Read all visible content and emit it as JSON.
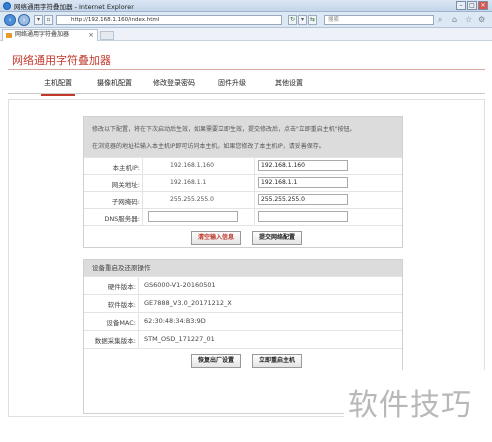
{
  "window": {
    "title": "网络通用字符叠加器 - Internet Explorer",
    "minimize": "–",
    "maximize": "□",
    "close": "✕"
  },
  "addressbar": {
    "url": "http://192.168.1.160/index.html",
    "search_placeholder": "搜索"
  },
  "tab": {
    "label": "网络通用字符叠加器"
  },
  "page": {
    "title": "网络通用字符叠加器",
    "menu": [
      "主机配置",
      "摄像机配置",
      "修改登录密码",
      "固件升级",
      "其他设置"
    ]
  },
  "network": {
    "notice": [
      "修改以下配置，将在下次启动后生效，如果需要立即生效，提交修改后，点击\"立即重启主机\"按钮。",
      "在浏览器的地址栏输入本主机IP即可访问本主机，如果您修改了本主机IP，请妥善保存。"
    ],
    "rows": [
      {
        "label": "本主机IP:",
        "current": "192.168.1.160",
        "input": "192.168.1.160"
      },
      {
        "label": "网关地址:",
        "current": "192.168.1.1",
        "input": "192.168.1.1"
      },
      {
        "label": "子网掩码:",
        "current": "255.255.255.0",
        "input": "255.255.255.0"
      },
      {
        "label": "DNS服务器:",
        "current": "",
        "input": ""
      }
    ],
    "clear_button": "清空输入信息",
    "submit_button": "提交网络配置"
  },
  "device": {
    "header": "设备重启及还原操作",
    "rows": [
      {
        "label": "硬件版本:",
        "value": "GS6000-V1-20160501"
      },
      {
        "label": "软件版本:",
        "value": "GE7888_V3.0_20171212_X"
      },
      {
        "label": "设备MAC:",
        "value": "62:30:48:34:B3:9D"
      },
      {
        "label": "数据采集版本:",
        "value": "STM_OSD_171227_01"
      }
    ],
    "restore_button": "恢复出厂设置",
    "reboot_button": "立即重启主机"
  },
  "watermark": "软件技巧"
}
